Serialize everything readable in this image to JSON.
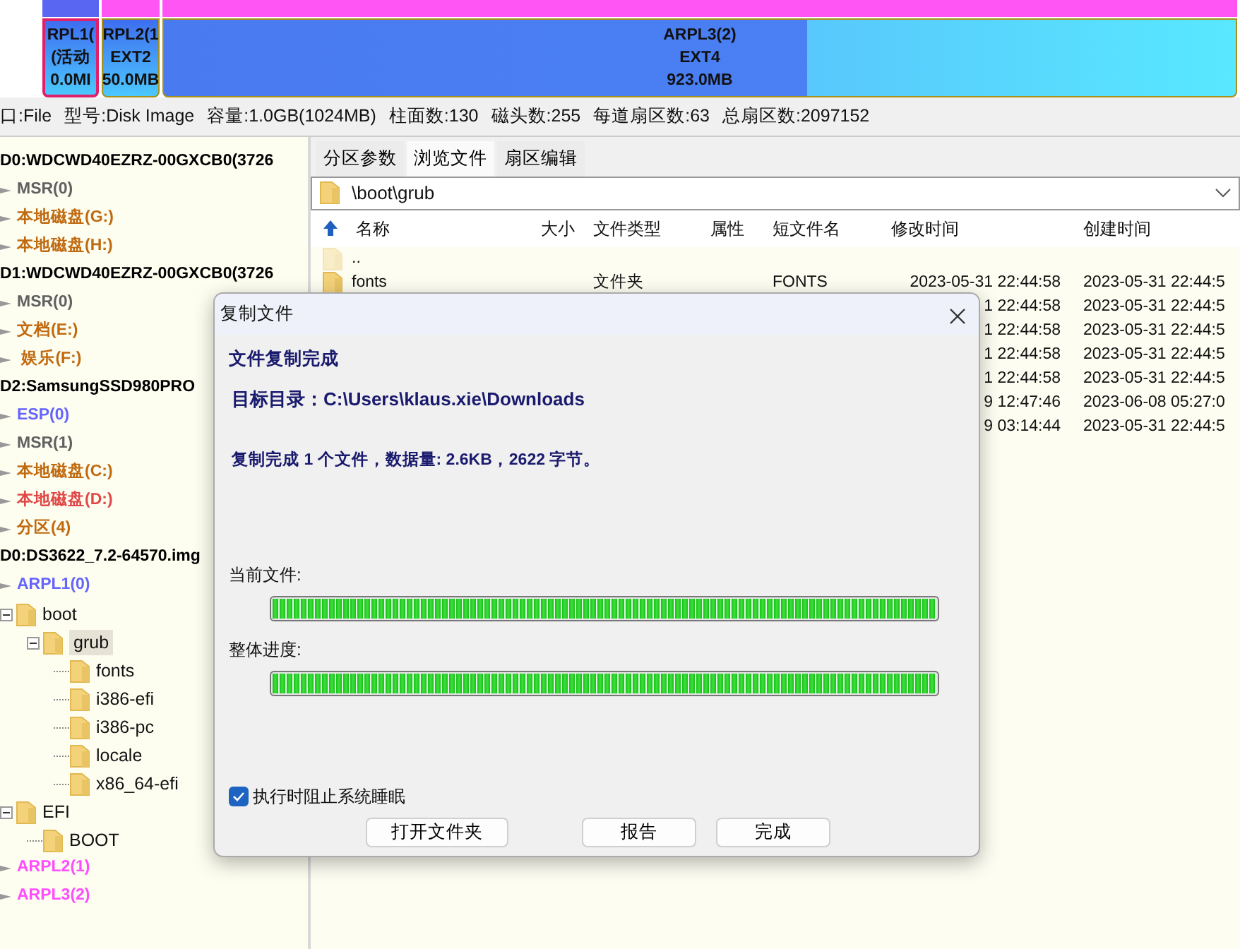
{
  "disk_bar": {
    "segments": [
      {
        "lines": [
          "RPL1(",
          "(活动",
          "0.0MI"
        ],
        "selected": true,
        "color": "#5866f2"
      },
      {
        "lines": [
          "RPL2(1",
          "EXT2",
          "50.0MB"
        ],
        "selected": false,
        "color": "#ff55f4"
      },
      {
        "lines": [
          "ARPL3(2)",
          "EXT4",
          "923.0MB"
        ],
        "selected": false,
        "color": "#ff55f4"
      }
    ]
  },
  "disk_info": [
    "口:File",
    "型号:Disk Image",
    "容量:1.0GB(1024MB)",
    "柱面数:130",
    "磁头数:255",
    "每道扇区数:63",
    "总扇区数:2097152"
  ],
  "tree": [
    {
      "label": "D0:WDCWD40EZRZ-00GXCB0(3726",
      "kind": "disk",
      "children": [
        {
          "label": "MSR(0)",
          "kind": "partition",
          "color": "#606060"
        },
        {
          "label": "本地磁盘(G:)",
          "kind": "partition",
          "color": "#c06a10"
        },
        {
          "label": "本地磁盘(H:)",
          "kind": "partition",
          "color": "#c06a10"
        }
      ]
    },
    {
      "label": "D1:WDCWD40EZRZ-00GXCB0(3726",
      "kind": "disk",
      "children": [
        {
          "label": "MSR(0)",
          "kind": "partition",
          "color": "#606060"
        },
        {
          "label": "文档(E:)",
          "kind": "partition",
          "color": "#c06a10"
        },
        {
          "label": " 娱乐(F:)",
          "kind": "partition",
          "color": "#c06a10"
        }
      ]
    },
    {
      "label": "D2:SamsungSSD980PRO",
      "kind": "disk",
      "children": [
        {
          "label": "ESP(0)",
          "kind": "partition",
          "color": "#6464ff"
        },
        {
          "label": "MSR(1)",
          "kind": "partition",
          "color": "#606060"
        },
        {
          "label": "本地磁盘(C:)",
          "kind": "partition",
          "color": "#c06a10"
        },
        {
          "label": "本地磁盘(D:)",
          "kind": "partition",
          "color": "#e04848"
        },
        {
          "label": "分区(4)",
          "kind": "partition",
          "color": "#c06a10"
        }
      ]
    },
    {
      "label": "D0:DS3622_7.2-64570.img",
      "kind": "disk",
      "children": [
        {
          "label": "ARPL1(0)",
          "kind": "partition",
          "color": "#6464ff",
          "children": [
            {
              "label": "boot",
              "kind": "folder",
              "expanded": true,
              "selected": false,
              "children": [
                {
                  "label": "grub",
                  "kind": "folder",
                  "expanded": true,
                  "selected": true,
                  "children": [
                    {
                      "label": "fonts",
                      "kind": "folder",
                      "selected": false
                    },
                    {
                      "label": "i386-efi",
                      "kind": "folder",
                      "selected": false
                    },
                    {
                      "label": "i386-pc",
                      "kind": "folder",
                      "selected": false
                    },
                    {
                      "label": "locale",
                      "kind": "folder",
                      "selected": false
                    },
                    {
                      "label": "x86_64-efi",
                      "kind": "folder",
                      "selected": false
                    }
                  ]
                }
              ]
            },
            {
              "label": "EFI",
              "kind": "folder",
              "expanded": true,
              "selected": false,
              "children": [
                {
                  "label": "BOOT",
                  "kind": "folder",
                  "selected": false
                }
              ]
            }
          ]
        },
        {
          "label": "ARPL2(1)",
          "kind": "partition",
          "color": "#ff4cff"
        },
        {
          "label": "ARPL3(2)",
          "kind": "partition",
          "color": "#ff4cff"
        }
      ]
    }
  ],
  "tabs": [
    {
      "label": "分区参数",
      "selected": false
    },
    {
      "label": "浏览文件",
      "selected": true
    },
    {
      "label": "扇区编辑",
      "selected": false
    }
  ],
  "path": "\\boot\\grub",
  "table": {
    "columns": [
      "名称",
      "大小",
      "文件类型",
      "属性",
      "短文件名",
      "修改时间",
      "创建时间"
    ],
    "rows": [
      {
        "kind": "parent",
        "name": ".."
      },
      {
        "kind": "folder",
        "name": "fonts",
        "type": "文件夹",
        "short": "FONTS",
        "modified": "2023-05-31 22:44:58",
        "created": "2023-05-31 22:44:5"
      },
      {
        "modified": "1 22:44:58",
        "created": "2023-05-31 22:44:5"
      },
      {
        "modified": "1 22:44:58",
        "created": "2023-05-31 22:44:5"
      },
      {
        "modified": "1 22:44:58",
        "created": "2023-05-31 22:44:5"
      },
      {
        "modified": "1 22:44:58",
        "created": "2023-05-31 22:44:5"
      },
      {
        "modified": "9 12:47:46",
        "created": "2023-06-08 05:27:0"
      },
      {
        "modified": "9 03:14:44",
        "created": "2023-05-31 22:44:5"
      }
    ]
  },
  "dialog": {
    "title": "复制文件",
    "heading": "文件复制完成",
    "target": "目标目录：C:\\Users\\klaus.xie\\Downloads",
    "summary": "复制完成 1 个文件，数据量: 2.6KB，2622 字节。",
    "progress": [
      {
        "label": "当前文件:",
        "level": 1
      },
      {
        "label": "整体进度:",
        "level": 1
      }
    ],
    "checkbox": {
      "label": "执行时阻止系统睡眠",
      "checked": true
    },
    "buttons": [
      "打开文件夹",
      "报告",
      "完成"
    ]
  }
}
